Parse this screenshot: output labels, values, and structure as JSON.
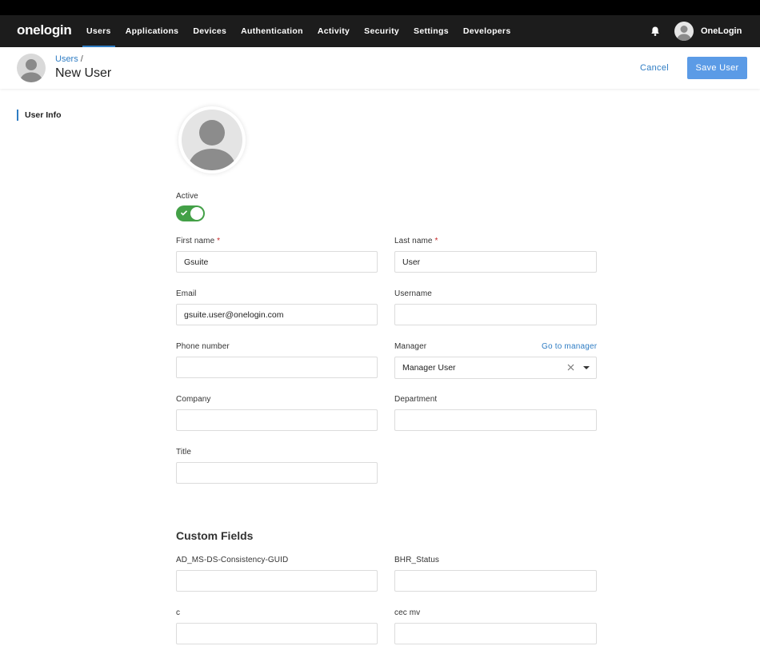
{
  "nav": {
    "logo": "onelogin",
    "items": [
      {
        "label": "Users",
        "active": true
      },
      {
        "label": "Applications"
      },
      {
        "label": "Devices"
      },
      {
        "label": "Authentication"
      },
      {
        "label": "Activity"
      },
      {
        "label": "Security"
      },
      {
        "label": "Settings"
      },
      {
        "label": "Developers"
      }
    ],
    "account_name": "OneLogin",
    "icons": {
      "notifications": "bell-icon",
      "account": "user-avatar-icon"
    }
  },
  "header": {
    "breadcrumb_parent": "Users",
    "breadcrumb_separator": "/",
    "title": "New User",
    "cancel_label": "Cancel",
    "save_label": "Save User"
  },
  "sidebar": {
    "items": [
      {
        "label": "User Info",
        "active": true
      }
    ]
  },
  "form": {
    "active_label": "Active",
    "active": true,
    "first_name": {
      "label": "First name",
      "required": "*",
      "value": "Gsuite"
    },
    "last_name": {
      "label": "Last name",
      "required": "*",
      "value": "User"
    },
    "email": {
      "label": "Email",
      "value": "gsuite.user@onelogin.com"
    },
    "username": {
      "label": "Username",
      "value": ""
    },
    "phone": {
      "label": "Phone number",
      "value": ""
    },
    "manager": {
      "label": "Manager",
      "link": "Go to manager",
      "value": "Manager User"
    },
    "company": {
      "label": "Company",
      "value": ""
    },
    "department": {
      "label": "Department",
      "value": ""
    },
    "title": {
      "label": "Title",
      "value": ""
    }
  },
  "custom_fields": {
    "title": "Custom Fields",
    "fields": [
      {
        "label": "AD_MS-DS-Consistency-GUID",
        "value": ""
      },
      {
        "label": "BHR_Status",
        "value": ""
      },
      {
        "label": "c",
        "value": ""
      },
      {
        "label": "cec mv",
        "value": ""
      }
    ]
  },
  "colors": {
    "accent": "#2f7dc4",
    "primary_button": "#5b9be6",
    "toggle_on": "#43a047",
    "nav_bg": "#1c1c1c"
  }
}
